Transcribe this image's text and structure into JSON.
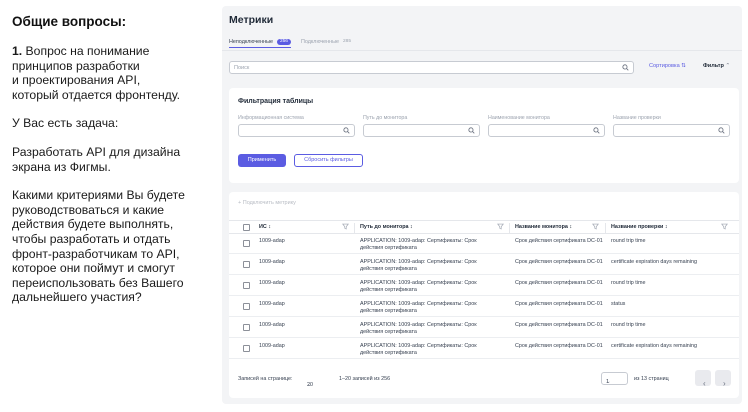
{
  "left": {
    "heading": "Общие вопросы:",
    "q_num": "1.",
    "q_text": " Вопрос на понимание\nпринципов разработки\nи проектирования API,\nкоторый отдается фронтенду.",
    "task": "У Вас есть задача:",
    "design": "Разработать API для дизайна\nэкрана из Фигмы.",
    "criteria": "Какими критериями Вы будете\nруководствоваться и какие\nдействия будете выполнять,\nчтобы разработать и отдать\nфронт-разработчикам то API,\nкоторое они поймут и смогут\nпереиспользовать без Вашего\nдальнейшего участия?"
  },
  "app": {
    "title": "Метрики",
    "tabs": [
      {
        "label": "Неподключенные",
        "count": "256",
        "active": true
      },
      {
        "label": "Подключенные",
        "count": "285",
        "active": false
      }
    ],
    "search_placeholder": "Поиск",
    "sort_label": "Сортировка",
    "filter_label": "Фильтр",
    "filter_panel": {
      "title": "Фильтрация таблицы",
      "fields": [
        "Информационная система",
        "Путь до монитора",
        "Наименование монитора",
        "Название проверки"
      ],
      "apply": "Применить",
      "reset": "Сбросить фильтры"
    },
    "add_metric": "+  Подключить метрику",
    "columns": [
      "ИС",
      "Путь до монитора",
      "Название монитора",
      "Название проверки"
    ],
    "rows": [
      {
        "is": "1009-adap",
        "path": "APPLICATION: 1009-adap: Сертификаты: Срок действия сертификата",
        "monitor": "Срок действия сертификата DC-01",
        "check": "round trip time"
      },
      {
        "is": "1009-adap",
        "path": "APPLICATION: 1009-adap: Сертификаты: Срок действия сертификата",
        "monitor": "Срок действия сертификата DC-01",
        "check": "certificate expiration days remaining"
      },
      {
        "is": "1009-adap",
        "path": "APPLICATION: 1009-adap: Сертификаты: Срок действия сертификата",
        "monitor": "Срок действия сертификата DC-01",
        "check": "round trip time"
      },
      {
        "is": "1009-adap",
        "path": "APPLICATION: 1009-adap: Сертификаты: Срок действия сертификата",
        "monitor": "Срок действия сертификата DC-01",
        "check": "status"
      },
      {
        "is": "1009-adap",
        "path": "APPLICATION: 1009-adap: Сертификаты: Срок действия сертификата",
        "monitor": "Срок действия сертификата DC-01",
        "check": "round trip time"
      },
      {
        "is": "1009-adap",
        "path": "APPLICATION: 1009-adap: Сертификаты: Срок действия сертификата",
        "monitor": "Срок действия сертификата DC-01",
        "check": "certificate expiration days remaining"
      }
    ],
    "footer": {
      "per_page_label": "Записей на странице:",
      "per_page": "20",
      "range": "1–20 записей из 256",
      "page": "1",
      "of_pages": "из 13 страниц"
    },
    "accent": "#5b5ce2"
  }
}
